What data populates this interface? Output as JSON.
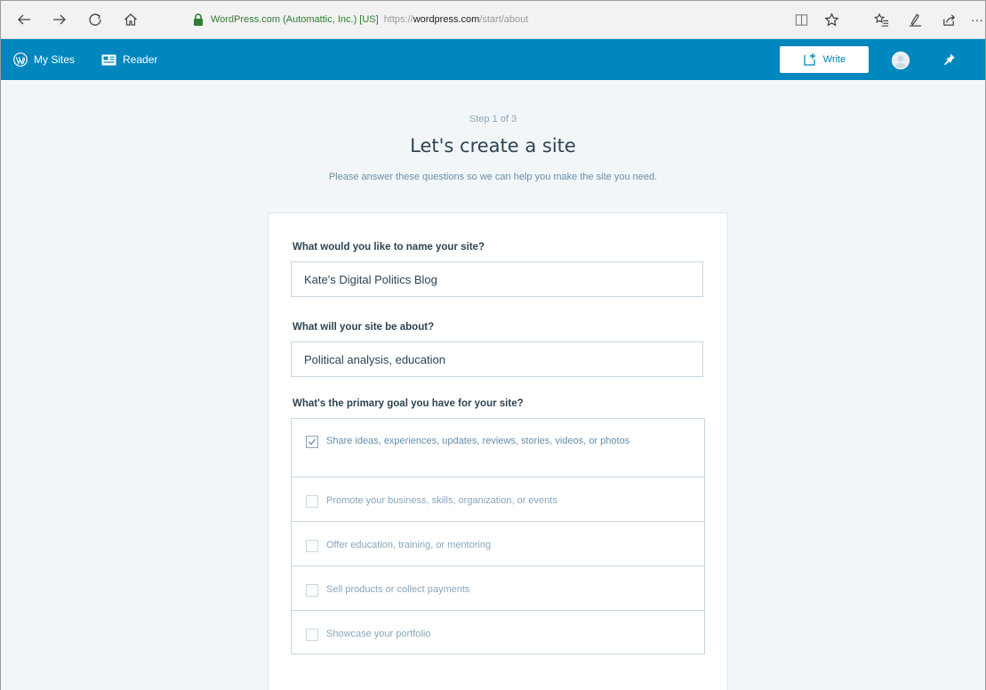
{
  "browser": {
    "site_identity": "WordPress.com (Automattic, Inc.) [US]",
    "url_proto": "https://",
    "url_host": "wordpress.com",
    "url_path": "/start/about",
    "overflow_label": "···"
  },
  "masterbar": {
    "my_sites": "My Sites",
    "reader": "Reader",
    "write": "Write",
    "color": "#0087be"
  },
  "page": {
    "step": "Step 1 of 3",
    "title": "Let's create a site",
    "subtitle": "Please answer these questions so we can help you make the site you need."
  },
  "form": {
    "name_question": "What would you like to name your site?",
    "name_value": "Kate's Digital Politics Blog",
    "about_question": "What will your site be about?",
    "about_value": "Political analysis, education",
    "goal_question": "What's the primary goal you have for your site?",
    "goals": [
      {
        "label": "Share ideas, experiences, updates, reviews, stories, videos, or photos",
        "checked": true
      },
      {
        "label": "Promote your business, skills, organization, or events",
        "checked": false
      },
      {
        "label": "Offer education, training, or mentoring",
        "checked": false
      },
      {
        "label": "Sell products or collect payments",
        "checked": false
      },
      {
        "label": "Showcase your portfolio",
        "checked": false
      }
    ]
  },
  "icons": {
    "back": "arrow-left-icon",
    "forward": "arrow-right-icon",
    "refresh": "refresh-icon",
    "home": "home-icon",
    "lock": "lock-icon",
    "reading_view": "reading-view-icon",
    "favorite": "star-icon",
    "favorites_list": "favorites-list-icon",
    "notes": "pen-icon",
    "share": "share-icon",
    "wordpress": "wordpress-logo-icon",
    "reader": "reader-icon",
    "write": "write-icon",
    "notifications": "bell-icon"
  }
}
